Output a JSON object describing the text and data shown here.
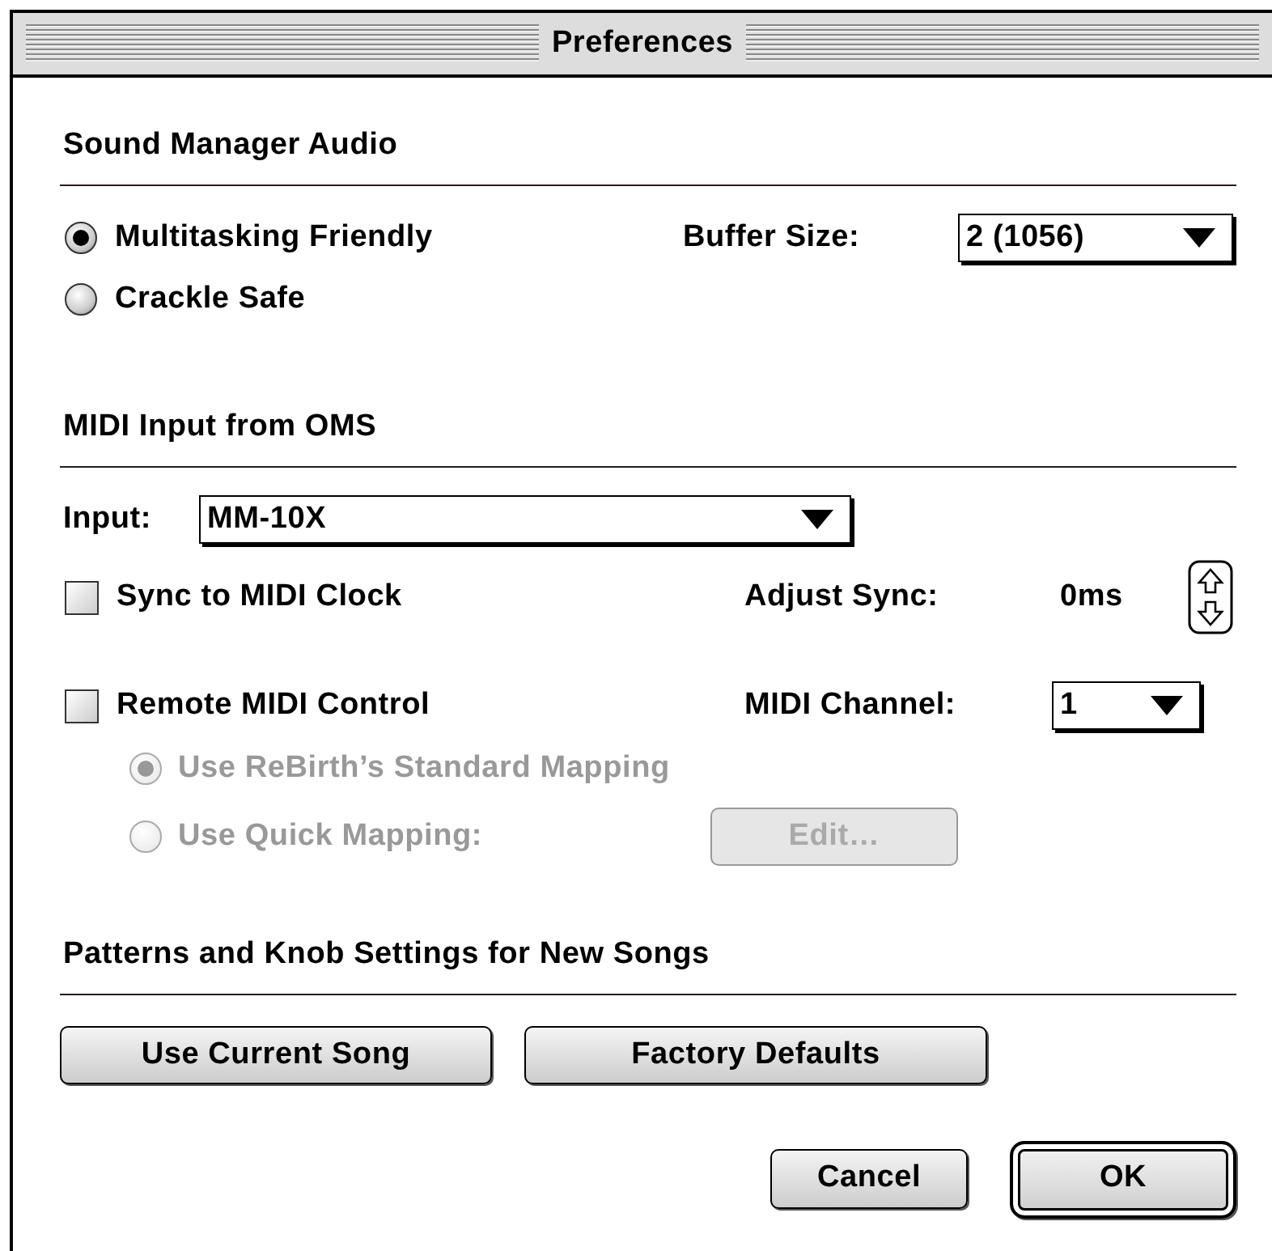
{
  "window": {
    "title": "Preferences"
  },
  "sound_manager": {
    "heading": "Sound Manager Audio",
    "modes": [
      {
        "label": "Multitasking Friendly",
        "selected": true
      },
      {
        "label": "Crackle Safe",
        "selected": false
      }
    ],
    "buffer_size": {
      "label": "Buffer Size:",
      "value": "2 (1056)"
    }
  },
  "midi_input": {
    "heading": "MIDI Input from OMS",
    "input": {
      "label": "Input:",
      "value": "MM-10X"
    },
    "sync": {
      "label": "Sync to MIDI Clock",
      "checked": false
    },
    "adjust_sync": {
      "label": "Adjust Sync:",
      "value": "0ms"
    },
    "remote": {
      "label": "Remote MIDI Control",
      "checked": false
    },
    "midi_channel": {
      "label": "MIDI Channel:",
      "value": "1"
    },
    "mappings": [
      {
        "label": "Use ReBirth’s Standard Mapping",
        "selected": true,
        "disabled": true
      },
      {
        "label": "Use Quick Mapping:",
        "selected": false,
        "disabled": true
      }
    ],
    "edit_button": {
      "label": "Edit…",
      "disabled": true
    }
  },
  "new_songs": {
    "heading": "Patterns and Knob Settings for New Songs",
    "buttons": [
      "Use Current Song",
      "Factory Defaults"
    ]
  },
  "dialog_buttons": [
    {
      "label": "Cancel",
      "default": false
    },
    {
      "label": "OK",
      "default": true
    }
  ]
}
